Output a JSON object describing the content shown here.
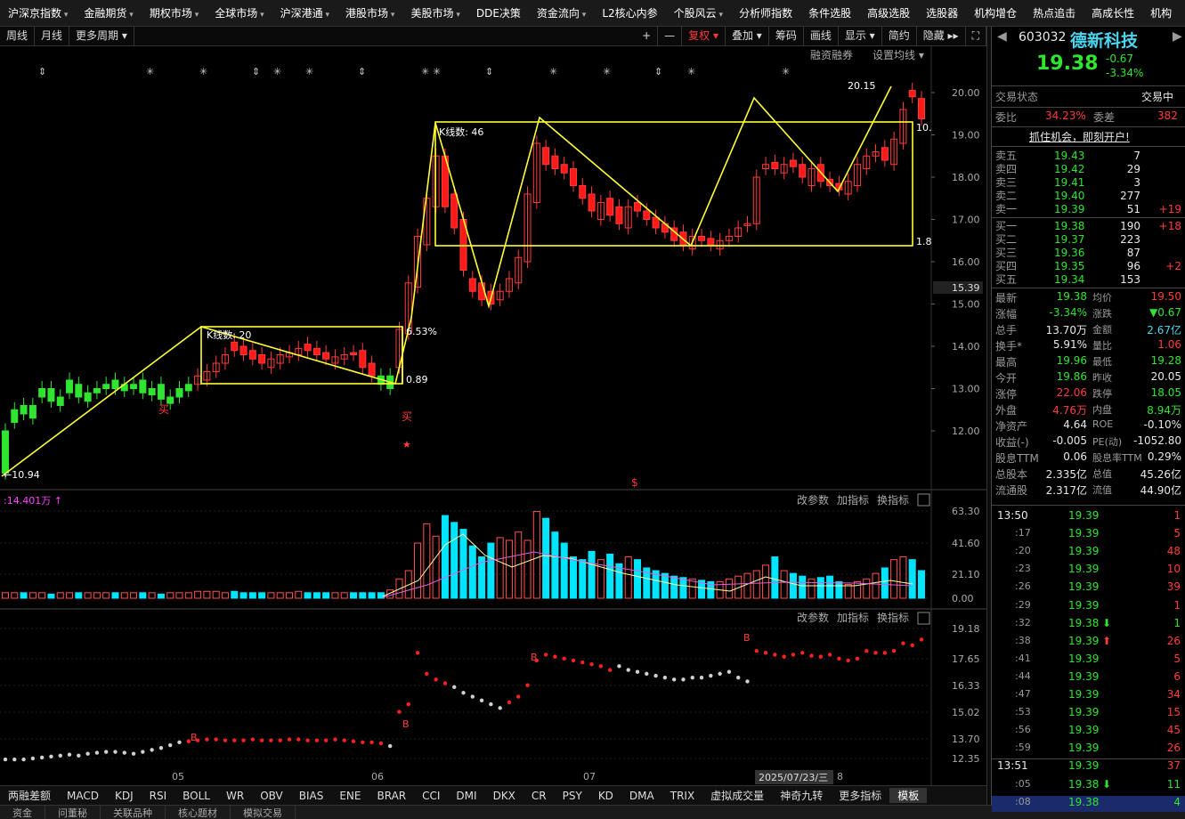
{
  "topmenu": [
    {
      "label": "沪深京指数",
      "dd": true
    },
    {
      "label": "金融期货",
      "dd": true
    },
    {
      "label": "期权市场",
      "dd": true
    },
    {
      "label": "全球市场",
      "dd": true
    },
    {
      "label": "沪深港通",
      "dd": true
    },
    {
      "label": "港股市场",
      "dd": true
    },
    {
      "label": "美股市场",
      "dd": true
    },
    {
      "label": "DDE决策",
      "dd": false
    },
    {
      "label": "资金流向",
      "dd": true
    },
    {
      "label": "L2核心内参",
      "dd": false
    },
    {
      "label": "个股风云",
      "dd": true
    },
    {
      "label": "分析师指数",
      "dd": false
    },
    {
      "label": "条件选股",
      "dd": false
    },
    {
      "label": "高级选股",
      "dd": false
    },
    {
      "label": "选股器",
      "dd": false
    },
    {
      "label": "机构增仓",
      "dd": false
    },
    {
      "label": "热点追击",
      "dd": false
    },
    {
      "label": "高成长性",
      "dd": false
    },
    {
      "label": "机构",
      "dd": false
    }
  ],
  "toolbar": {
    "left": [
      "周线",
      "月线",
      "更多周期 ▾"
    ],
    "plus": "+",
    "minus": "—",
    "fuquan": "复权 ▾",
    "diejia": "叠加 ▾",
    "chouma": "筹码",
    "huaxian": "画线",
    "xianshi": "显示 ▾",
    "jianyue": "简约",
    "yincang": "隐藏 ▸▸"
  },
  "chart": {
    "labels": {
      "rongzi": "融资融券",
      "shezhi": "设置均线 ▾",
      "high": "20.15",
      "low": "10.94",
      "box1": "K线数: 20",
      "box2": "K线数: 46",
      "pct": "6.53%",
      "b1right": "0.89",
      "b2right1": "10.",
      "b2right2": "1.8",
      "buy1": "买",
      "buy2": "买",
      "dollar": "$",
      "vollabel": ":14.401万 ↑",
      "gaicanshu": "改参数",
      "jiazhibiao": "加指标",
      "huanzhibiao": "换指标",
      "curprice": "15.39",
      "datebox": "2025/07/23/三",
      "month8": "8"
    },
    "yaxis": [
      "20.00",
      "19.00",
      "18.00",
      "17.00",
      "16.00",
      "15.00",
      "14.00",
      "13.00",
      "12.00"
    ],
    "volaxis": [
      "63.30",
      "41.60",
      "21.10",
      "0.00"
    ],
    "sar_axis": [
      "19.18",
      "17.65",
      "16.33",
      "15.02",
      "13.70",
      "12.35"
    ],
    "months": [
      "05",
      "06",
      "07"
    ]
  },
  "bottomtabs": [
    "两融差额",
    "MACD",
    "KDJ",
    "RSI",
    "BOLL",
    "WR",
    "OBV",
    "BIAS",
    "ENE",
    "BRAR",
    "CCI",
    "DMI",
    "DKX",
    "CR",
    "PSY",
    "KD",
    "DMA",
    "TRIX",
    "虚拟成交量",
    "神奇九转",
    "更多指标",
    "模板"
  ],
  "bottomtabs2": [
    "资金",
    "问董秘",
    "关联品种",
    "核心题材",
    "模拟交易"
  ],
  "quote": {
    "code": "603032",
    "name": "德新科技",
    "price": "19.38",
    "chg": "-0.67",
    "pct": "-3.34%",
    "status_label": "交易状态",
    "status": "交易中",
    "weibi_label": "委比",
    "weibi": "34.23%",
    "weicha_label": "委差",
    "weicha": "382",
    "promo": "抓住机会，即刻开户!",
    "asks": [
      {
        "l": "卖五",
        "p": "19.43",
        "v": "7",
        "d": ""
      },
      {
        "l": "卖四",
        "p": "19.42",
        "v": "29",
        "d": ""
      },
      {
        "l": "卖三",
        "p": "19.41",
        "v": "3",
        "d": ""
      },
      {
        "l": "卖二",
        "p": "19.40",
        "v": "277",
        "d": ""
      },
      {
        "l": "卖一",
        "p": "19.39",
        "v": "51",
        "d": "+19"
      }
    ],
    "bids": [
      {
        "l": "买一",
        "p": "19.38",
        "v": "190",
        "d": "+18"
      },
      {
        "l": "买二",
        "p": "19.37",
        "v": "223",
        "d": ""
      },
      {
        "l": "买三",
        "p": "19.36",
        "v": "87",
        "d": ""
      },
      {
        "l": "买四",
        "p": "19.35",
        "v": "96",
        "d": "+2"
      },
      {
        "l": "买五",
        "p": "19.34",
        "v": "153",
        "d": ""
      }
    ],
    "stats": [
      {
        "a": "最新",
        "av": "19.38",
        "ac": "green",
        "b": "均价",
        "bv": "19.50",
        "bc": "red"
      },
      {
        "a": "涨幅",
        "av": "-3.34%",
        "ac": "green",
        "b": "涨跌",
        "bv": "▼0.67",
        "bc": "green"
      },
      {
        "a": "总手",
        "av": "13.70万",
        "ac": "white",
        "b": "金额",
        "bv": "2.67亿",
        "bc": "cyan"
      },
      {
        "a": "换手*",
        "av": "5.91%",
        "ac": "white",
        "b": "量比",
        "bv": "1.06",
        "bc": "red"
      },
      {
        "a": "最高",
        "av": "19.96",
        "ac": "green",
        "b": "最低",
        "bv": "19.28",
        "bc": "green"
      },
      {
        "a": "今开",
        "av": "19.86",
        "ac": "green",
        "b": "昨收",
        "bv": "20.05",
        "bc": "white"
      },
      {
        "a": "涨停",
        "av": "22.06",
        "ac": "red",
        "b": "跌停",
        "bv": "18.05",
        "bc": "green"
      },
      {
        "a": "外盘",
        "av": "4.76万",
        "ac": "red",
        "b": "内盘",
        "bv": "8.94万",
        "bc": "green"
      },
      {
        "a": "净资产",
        "av": "4.64",
        "ac": "white",
        "b": "ROE",
        "bv": "-0.10%",
        "bc": "white"
      },
      {
        "a": "收益(-)",
        "av": "-0.005",
        "ac": "white",
        "b": "PE(动)",
        "bv": "-1052.80",
        "bc": "white"
      },
      {
        "a": "股息TTM",
        "av": "0.06",
        "ac": "white",
        "b": "股息率TTM",
        "bv": "0.29%",
        "bc": "white"
      },
      {
        "a": "总股本",
        "av": "2.335亿",
        "ac": "white",
        "b": "总值",
        "bv": "45.26亿",
        "bc": "white"
      },
      {
        "a": "流通股",
        "av": "2.317亿",
        "ac": "white",
        "b": "流值",
        "bv": "44.90亿",
        "bc": "white"
      }
    ],
    "ticks": [
      {
        "t": "13:50",
        "p": "19.39",
        "v": "1",
        "vc": "red",
        "arr": ""
      },
      {
        "t": ":17",
        "p": "19.39",
        "v": "5",
        "vc": "red",
        "arr": ""
      },
      {
        "t": ":20",
        "p": "19.39",
        "v": "48",
        "vc": "red",
        "arr": ""
      },
      {
        "t": ":23",
        "p": "19.39",
        "v": "10",
        "vc": "red",
        "arr": ""
      },
      {
        "t": ":26",
        "p": "19.39",
        "v": "39",
        "vc": "red",
        "arr": ""
      },
      {
        "t": ":29",
        "p": "19.39",
        "v": "1",
        "vc": "red",
        "arr": ""
      },
      {
        "t": ":32",
        "p": "19.38",
        "v": "1",
        "vc": "green",
        "arr": "⬇"
      },
      {
        "t": ":38",
        "p": "19.39",
        "v": "26",
        "vc": "red",
        "arr": "⬆"
      },
      {
        "t": ":41",
        "p": "19.39",
        "v": "5",
        "vc": "red",
        "arr": ""
      },
      {
        "t": ":44",
        "p": "19.39",
        "v": "6",
        "vc": "red",
        "arr": ""
      },
      {
        "t": ":47",
        "p": "19.39",
        "v": "34",
        "vc": "red",
        "arr": ""
      },
      {
        "t": ":53",
        "p": "19.39",
        "v": "15",
        "vc": "red",
        "arr": ""
      },
      {
        "t": ":56",
        "p": "19.39",
        "v": "45",
        "vc": "red",
        "arr": ""
      },
      {
        "t": ":59",
        "p": "19.39",
        "v": "26",
        "vc": "red",
        "arr": ""
      },
      {
        "t": "13:51",
        "p": "19.39",
        "v": "37",
        "vc": "red",
        "arr": ""
      },
      {
        "t": ":05",
        "p": "19.38",
        "v": "11",
        "vc": "green",
        "arr": "⬇"
      },
      {
        "t": ":08",
        "p": "19.38",
        "v": "4",
        "vc": "green",
        "arr": ""
      }
    ]
  }
}
